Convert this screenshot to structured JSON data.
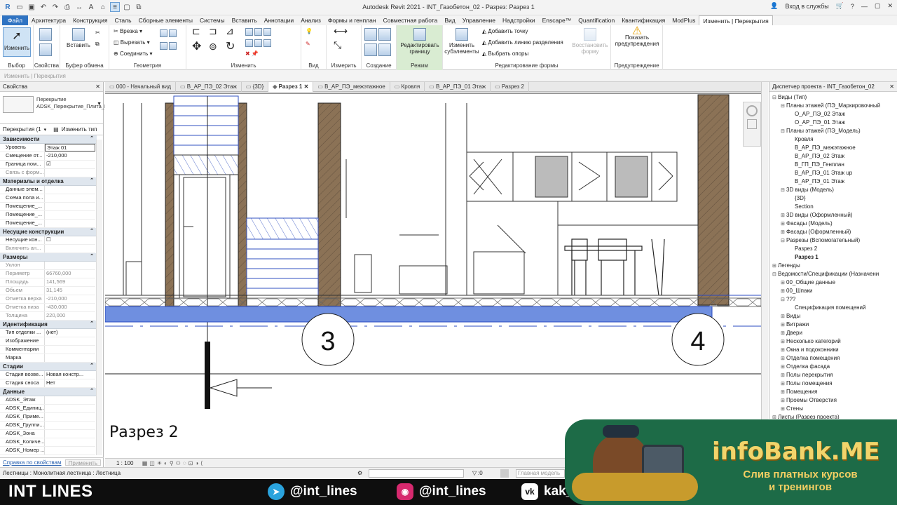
{
  "titlebar": {
    "title": "Autodesk Revit 2021 - INT_Газобетон_02 - Разрез: Разрез 1",
    "signin": "Вход в службы"
  },
  "menu": [
    "Файл",
    "Архитектура",
    "Конструкция",
    "Сталь",
    "Сборные элементы",
    "Системы",
    "Вставить",
    "Аннотации",
    "Анализ",
    "Формы и генплан",
    "Совместная работа",
    "Вид",
    "Управление",
    "Надстройки",
    "Enscape™",
    "Quantification",
    "Квантификация",
    "ModPlus",
    "Изменить | Перекрытия"
  ],
  "ribbon": {
    "select": {
      "btn": "Изменить",
      "label": "Выбор"
    },
    "properties": {
      "label": "Свойства"
    },
    "clipboard": {
      "btn": "Вставить",
      "label": "Буфер обмена"
    },
    "geometry": {
      "cut": "Врезка",
      "cutout": "Вырезать",
      "join": "Соединить",
      "label": "Геометрия"
    },
    "modify": {
      "label": "Изменить"
    },
    "view": {
      "label": "Вид"
    },
    "measure": {
      "label": "Измерить"
    },
    "create": {
      "label": "Создание"
    },
    "mode": {
      "btn": "Редактировать границу",
      "label": "Режим"
    },
    "shape": {
      "sub": "Изменить субэлементы",
      "add_point": "Добавить точку",
      "add_split": "Добавить линию разделения",
      "pick_supports": "Выбрать опоры",
      "label": "Редактирование формы",
      "reset": "Восстановить форму"
    },
    "warnings": {
      "btn": "Показать предупреждения",
      "label": "Предупреждение"
    }
  },
  "contextbar": "Изменить | Перекрытия",
  "properties": {
    "header": "Свойства",
    "family": "Перекрытие",
    "type": "ADSK_Перекрытие_Плита_Бетон_220",
    "selector": "Перекрытия (1",
    "edit_type": "Изменить тип",
    "sections": [
      {
        "title": "Зависимости",
        "rows": [
          [
            "Уровень",
            "Этаж 01"
          ],
          [
            "Смещение от...",
            "-210,000"
          ],
          [
            "Граница пом...",
            "☑"
          ],
          [
            "Связь с форм...",
            ""
          ]
        ]
      },
      {
        "title": "Материалы и отделка",
        "rows": [
          [
            "Данные элем...",
            ""
          ],
          [
            "Схема пола и...",
            ""
          ],
          [
            "Помещение_...",
            ""
          ],
          [
            "Помещение_...",
            ""
          ],
          [
            "Помещение_...",
            ""
          ]
        ]
      },
      {
        "title": "Несущие конструкции",
        "rows": [
          [
            "Несущие кон...",
            "☐"
          ],
          [
            "Включить ан...",
            ""
          ]
        ]
      },
      {
        "title": "Размеры",
        "rows": [
          [
            "Уклон",
            ""
          ],
          [
            "Периметр",
            "66760,000"
          ],
          [
            "Площадь",
            "141,569"
          ],
          [
            "Объем",
            "31,145"
          ],
          [
            "Отметка верха",
            "-210,000"
          ],
          [
            "Отметка низа",
            "-430,000"
          ],
          [
            "Толщина",
            "220,000"
          ]
        ]
      },
      {
        "title": "Идентификация",
        "rows": [
          [
            "Тип отделки ...",
            "(нет)"
          ],
          [
            "Изображение",
            ""
          ],
          [
            "Комментарии",
            ""
          ],
          [
            "Марка",
            ""
          ]
        ]
      },
      {
        "title": "Стадии",
        "rows": [
          [
            "Стадия возве...",
            "Новая констр..."
          ],
          [
            "Стадия сноса",
            "Нет"
          ]
        ]
      },
      {
        "title": "Данные",
        "rows": [
          [
            "ADSK_Этаж",
            ""
          ],
          [
            "ADSK_Единиц...",
            ""
          ],
          [
            "ADSK_Приме...",
            ""
          ],
          [
            "ADSK_Группи...",
            ""
          ],
          [
            "ADSK_Зона",
            ""
          ],
          [
            "ADSK_Количе...",
            ""
          ],
          [
            "ADSK_Номер ...",
            ""
          ]
        ]
      }
    ],
    "help": "Справка по свойствам",
    "apply": "Применить"
  },
  "tabs": [
    "000 - Начальный вид",
    "В_АР_ПЭ_02 Этаж",
    "{3D}",
    "Разрез 1",
    "В_АР_ПЭ_межэтажное",
    "Кровля",
    "В_АР_ПЭ_01 Этаж",
    "Разрез 2"
  ],
  "active_tab": "Разрез 1",
  "canvas": {
    "bubble3": "3",
    "bubble4": "4",
    "section_label": "Разрез 2"
  },
  "viewbar": {
    "scale": "1 : 100"
  },
  "browser": {
    "title": "Диспетчер проекта - INT_Газобетон_02",
    "items": [
      {
        "t": "Виды (Тип)",
        "d": 0,
        "ex": "⊟"
      },
      {
        "t": "Планы этажей (ПЭ_Маркировочный",
        "d": 1,
        "ex": "⊟"
      },
      {
        "t": "О_АР_ПЭ_02 Этаж",
        "d": 2,
        "ex": ""
      },
      {
        "t": "О_АР_ПЭ_01 Этаж",
        "d": 2,
        "ex": ""
      },
      {
        "t": "Планы этажей (ПЭ_Модель)",
        "d": 1,
        "ex": "⊟"
      },
      {
        "t": "Кровля",
        "d": 2,
        "ex": ""
      },
      {
        "t": "В_АР_ПЭ_межэтажное",
        "d": 2,
        "ex": ""
      },
      {
        "t": "В_АР_ПЭ_02 Этаж",
        "d": 2,
        "ex": ""
      },
      {
        "t": "В_ГП_ПЭ_Генплан",
        "d": 2,
        "ex": ""
      },
      {
        "t": "В_АР_ПЭ_01 Этаж up",
        "d": 2,
        "ex": ""
      },
      {
        "t": "В_АР_ПЭ_01 Этаж",
        "d": 2,
        "ex": ""
      },
      {
        "t": "3D виды (Модель)",
        "d": 1,
        "ex": "⊟"
      },
      {
        "t": "{3D}",
        "d": 2,
        "ex": ""
      },
      {
        "t": "Section",
        "d": 2,
        "ex": ""
      },
      {
        "t": "3D виды (Оформленный)",
        "d": 1,
        "ex": "⊞"
      },
      {
        "t": "Фасады (Модель)",
        "d": 1,
        "ex": "⊞"
      },
      {
        "t": "Фасады (Оформленный)",
        "d": 1,
        "ex": "⊞"
      },
      {
        "t": "Разрезы (Вспомогательный)",
        "d": 1,
        "ex": "⊟"
      },
      {
        "t": "Разрез 2",
        "d": 2,
        "ex": ""
      },
      {
        "t": "Разрез 1",
        "d": 2,
        "ex": "",
        "b": true
      },
      {
        "t": "Легенды",
        "d": 0,
        "ex": "⊞"
      },
      {
        "t": "Ведомости/Спецификации (Назначени",
        "d": 0,
        "ex": "⊟"
      },
      {
        "t": "00_Общие данные",
        "d": 1,
        "ex": "⊞"
      },
      {
        "t": "00_Шпаки",
        "d": 1,
        "ex": "⊞"
      },
      {
        "t": "???",
        "d": 1,
        "ex": "⊟"
      },
      {
        "t": "Спецификация помещений",
        "d": 2,
        "ex": ""
      },
      {
        "t": "Виды",
        "d": 1,
        "ex": "⊞"
      },
      {
        "t": "Витражи",
        "d": 1,
        "ex": "⊞"
      },
      {
        "t": "Двери",
        "d": 1,
        "ex": "⊞"
      },
      {
        "t": "Несколько категорий",
        "d": 1,
        "ex": "⊞"
      },
      {
        "t": "Окна и подоконники",
        "d": 1,
        "ex": "⊞"
      },
      {
        "t": "Отделка помещения",
        "d": 1,
        "ex": "⊞"
      },
      {
        "t": "Отделка фасада",
        "d": 1,
        "ex": "⊞"
      },
      {
        "t": "Полы перекрытия",
        "d": 1,
        "ex": "⊞"
      },
      {
        "t": "Полы помещения",
        "d": 1,
        "ex": "⊞"
      },
      {
        "t": "Помещения",
        "d": 1,
        "ex": "⊞"
      },
      {
        "t": "Проемы Отверстия",
        "d": 1,
        "ex": "⊞"
      },
      {
        "t": "Стены",
        "d": 1,
        "ex": "⊞"
      },
      {
        "t": "Листы (Разрез проекта)",
        "d": 0,
        "ex": "⊞"
      }
    ]
  },
  "statusbar": {
    "text": "Лестницы : Монолитная лестница : Лестница",
    "zero": ":0",
    "model": "Главная модель"
  },
  "footer": {
    "brand": "INT LINES",
    "telegram": "@int_lines",
    "instagram": "@int_lines",
    "vk": "kak_"
  },
  "promo": {
    "logo": "infoBank.ME",
    "line1": "Слив платных курсов",
    "line2": "и тренингов"
  },
  "colors": {
    "accent": "#2f73c2",
    "slab": "#6f8fe0",
    "wall": "#8b7256",
    "promo_bg": "#1d6b47",
    "promo_text": "#f2d46b"
  }
}
